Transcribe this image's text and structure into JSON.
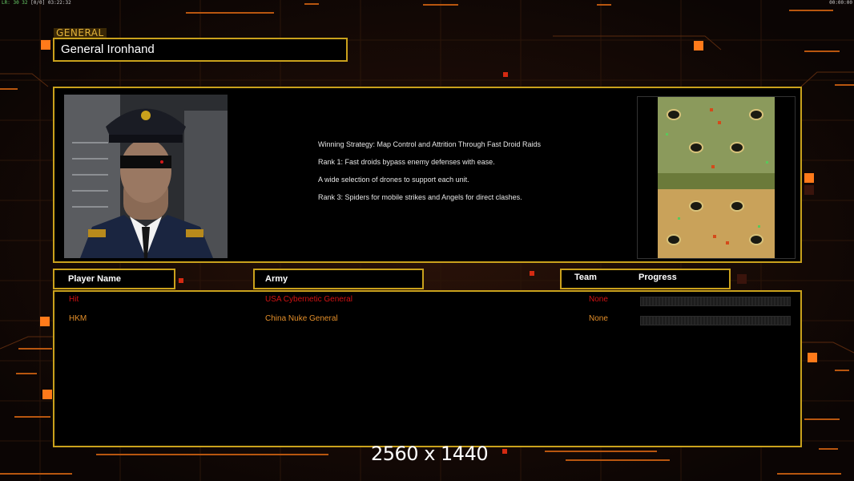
{
  "hud": {
    "fps_label": "LR:",
    "fps_values": "30 32",
    "fps_extra": "[0/0]",
    "clock": "03:22:32",
    "timer": "00:00:00"
  },
  "general": {
    "tag": "GENERAL",
    "name": "General Ironhand"
  },
  "strategy": {
    "lines": [
      "Winning Strategy: Map Control and Attrition Through Fast Droid Raids",
      "Rank 1: Fast droids bypass enemy defenses with ease.",
      "A wide selection of drones to support each unit.",
      "Rank 3: Spiders for mobile strikes and Angels for direct clashes."
    ]
  },
  "headers": {
    "player_name": "Player Name",
    "army": "Army",
    "team": "Team",
    "progress": "Progress"
  },
  "players": [
    {
      "name": "Hit",
      "army": "USA Cybernetic General",
      "team": "None",
      "progress": 0,
      "color": "#d31212"
    },
    {
      "name": "HKM",
      "army": "China Nuke General",
      "team": "None",
      "progress": 0,
      "color": "#e48f2a"
    }
  ],
  "resolution_label": "2560 x 1440",
  "colors": {
    "frame": "#c9a11c",
    "player1": "#d31212",
    "player2": "#e48f2a"
  },
  "icons": {
    "portrait": "general-portrait",
    "minimap": "map-preview"
  }
}
